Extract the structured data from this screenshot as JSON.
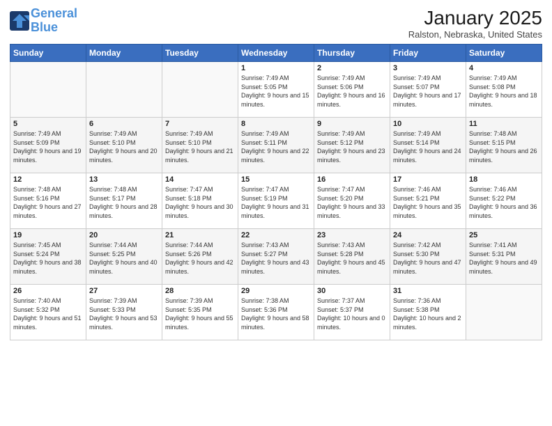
{
  "header": {
    "logo_line1": "General",
    "logo_line2": "Blue",
    "month": "January 2025",
    "location": "Ralston, Nebraska, United States"
  },
  "days_of_week": [
    "Sunday",
    "Monday",
    "Tuesday",
    "Wednesday",
    "Thursday",
    "Friday",
    "Saturday"
  ],
  "weeks": [
    [
      {
        "day": "",
        "sunrise": "",
        "sunset": "",
        "daylight": ""
      },
      {
        "day": "",
        "sunrise": "",
        "sunset": "",
        "daylight": ""
      },
      {
        "day": "",
        "sunrise": "",
        "sunset": "",
        "daylight": ""
      },
      {
        "day": "1",
        "sunrise": "Sunrise: 7:49 AM",
        "sunset": "Sunset: 5:05 PM",
        "daylight": "Daylight: 9 hours and 15 minutes."
      },
      {
        "day": "2",
        "sunrise": "Sunrise: 7:49 AM",
        "sunset": "Sunset: 5:06 PM",
        "daylight": "Daylight: 9 hours and 16 minutes."
      },
      {
        "day": "3",
        "sunrise": "Sunrise: 7:49 AM",
        "sunset": "Sunset: 5:07 PM",
        "daylight": "Daylight: 9 hours and 17 minutes."
      },
      {
        "day": "4",
        "sunrise": "Sunrise: 7:49 AM",
        "sunset": "Sunset: 5:08 PM",
        "daylight": "Daylight: 9 hours and 18 minutes."
      }
    ],
    [
      {
        "day": "5",
        "sunrise": "Sunrise: 7:49 AM",
        "sunset": "Sunset: 5:09 PM",
        "daylight": "Daylight: 9 hours and 19 minutes."
      },
      {
        "day": "6",
        "sunrise": "Sunrise: 7:49 AM",
        "sunset": "Sunset: 5:10 PM",
        "daylight": "Daylight: 9 hours and 20 minutes."
      },
      {
        "day": "7",
        "sunrise": "Sunrise: 7:49 AM",
        "sunset": "Sunset: 5:10 PM",
        "daylight": "Daylight: 9 hours and 21 minutes."
      },
      {
        "day": "8",
        "sunrise": "Sunrise: 7:49 AM",
        "sunset": "Sunset: 5:11 PM",
        "daylight": "Daylight: 9 hours and 22 minutes."
      },
      {
        "day": "9",
        "sunrise": "Sunrise: 7:49 AM",
        "sunset": "Sunset: 5:12 PM",
        "daylight": "Daylight: 9 hours and 23 minutes."
      },
      {
        "day": "10",
        "sunrise": "Sunrise: 7:49 AM",
        "sunset": "Sunset: 5:14 PM",
        "daylight": "Daylight: 9 hours and 24 minutes."
      },
      {
        "day": "11",
        "sunrise": "Sunrise: 7:48 AM",
        "sunset": "Sunset: 5:15 PM",
        "daylight": "Daylight: 9 hours and 26 minutes."
      }
    ],
    [
      {
        "day": "12",
        "sunrise": "Sunrise: 7:48 AM",
        "sunset": "Sunset: 5:16 PM",
        "daylight": "Daylight: 9 hours and 27 minutes."
      },
      {
        "day": "13",
        "sunrise": "Sunrise: 7:48 AM",
        "sunset": "Sunset: 5:17 PM",
        "daylight": "Daylight: 9 hours and 28 minutes."
      },
      {
        "day": "14",
        "sunrise": "Sunrise: 7:47 AM",
        "sunset": "Sunset: 5:18 PM",
        "daylight": "Daylight: 9 hours and 30 minutes."
      },
      {
        "day": "15",
        "sunrise": "Sunrise: 7:47 AM",
        "sunset": "Sunset: 5:19 PM",
        "daylight": "Daylight: 9 hours and 31 minutes."
      },
      {
        "day": "16",
        "sunrise": "Sunrise: 7:47 AM",
        "sunset": "Sunset: 5:20 PM",
        "daylight": "Daylight: 9 hours and 33 minutes."
      },
      {
        "day": "17",
        "sunrise": "Sunrise: 7:46 AM",
        "sunset": "Sunset: 5:21 PM",
        "daylight": "Daylight: 9 hours and 35 minutes."
      },
      {
        "day": "18",
        "sunrise": "Sunrise: 7:46 AM",
        "sunset": "Sunset: 5:22 PM",
        "daylight": "Daylight: 9 hours and 36 minutes."
      }
    ],
    [
      {
        "day": "19",
        "sunrise": "Sunrise: 7:45 AM",
        "sunset": "Sunset: 5:24 PM",
        "daylight": "Daylight: 9 hours and 38 minutes."
      },
      {
        "day": "20",
        "sunrise": "Sunrise: 7:44 AM",
        "sunset": "Sunset: 5:25 PM",
        "daylight": "Daylight: 9 hours and 40 minutes."
      },
      {
        "day": "21",
        "sunrise": "Sunrise: 7:44 AM",
        "sunset": "Sunset: 5:26 PM",
        "daylight": "Daylight: 9 hours and 42 minutes."
      },
      {
        "day": "22",
        "sunrise": "Sunrise: 7:43 AM",
        "sunset": "Sunset: 5:27 PM",
        "daylight": "Daylight: 9 hours and 43 minutes."
      },
      {
        "day": "23",
        "sunrise": "Sunrise: 7:43 AM",
        "sunset": "Sunset: 5:28 PM",
        "daylight": "Daylight: 9 hours and 45 minutes."
      },
      {
        "day": "24",
        "sunrise": "Sunrise: 7:42 AM",
        "sunset": "Sunset: 5:30 PM",
        "daylight": "Daylight: 9 hours and 47 minutes."
      },
      {
        "day": "25",
        "sunrise": "Sunrise: 7:41 AM",
        "sunset": "Sunset: 5:31 PM",
        "daylight": "Daylight: 9 hours and 49 minutes."
      }
    ],
    [
      {
        "day": "26",
        "sunrise": "Sunrise: 7:40 AM",
        "sunset": "Sunset: 5:32 PM",
        "daylight": "Daylight: 9 hours and 51 minutes."
      },
      {
        "day": "27",
        "sunrise": "Sunrise: 7:39 AM",
        "sunset": "Sunset: 5:33 PM",
        "daylight": "Daylight: 9 hours and 53 minutes."
      },
      {
        "day": "28",
        "sunrise": "Sunrise: 7:39 AM",
        "sunset": "Sunset: 5:35 PM",
        "daylight": "Daylight: 9 hours and 55 minutes."
      },
      {
        "day": "29",
        "sunrise": "Sunrise: 7:38 AM",
        "sunset": "Sunset: 5:36 PM",
        "daylight": "Daylight: 9 hours and 58 minutes."
      },
      {
        "day": "30",
        "sunrise": "Sunrise: 7:37 AM",
        "sunset": "Sunset: 5:37 PM",
        "daylight": "Daylight: 10 hours and 0 minutes."
      },
      {
        "day": "31",
        "sunrise": "Sunrise: 7:36 AM",
        "sunset": "Sunset: 5:38 PM",
        "daylight": "Daylight: 10 hours and 2 minutes."
      },
      {
        "day": "",
        "sunrise": "",
        "sunset": "",
        "daylight": ""
      }
    ]
  ]
}
